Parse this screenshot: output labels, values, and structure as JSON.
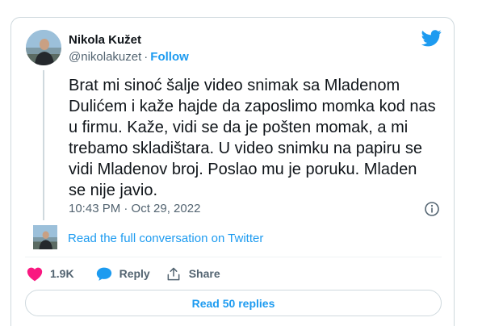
{
  "author": {
    "name": "Nikola Kužet",
    "handle": "@nikolakuzet",
    "separator": "·",
    "follow_label": "Follow"
  },
  "tweet": {
    "text": "Brat mi sinoć šalje video snimak sa Mladenom Dulićem i kaže hajde da zaposlimo momka kod nas u firmu. Kaže, vidi se da je pošten momak, a mi trebamo skladištara. U video snimku na papiru se vidi Mladenov broj. Poslao mu je poruku. Mladen se nije javio.",
    "timestamp": "10:43 PM · Oct 29, 2022"
  },
  "conversation_link": "Read the full conversation on Twitter",
  "actions": {
    "like_count": "1.9K",
    "reply_label": "Reply",
    "share_label": "Share"
  },
  "read_replies_label": "Read 50 replies",
  "colors": {
    "accent": "#1d9bf0",
    "like": "#f91880",
    "muted_text": "#536471",
    "border": "#cfd9de"
  },
  "icons": [
    "twitter-bird-icon",
    "info-icon",
    "heart-icon",
    "reply-bubble-icon",
    "share-icon"
  ]
}
